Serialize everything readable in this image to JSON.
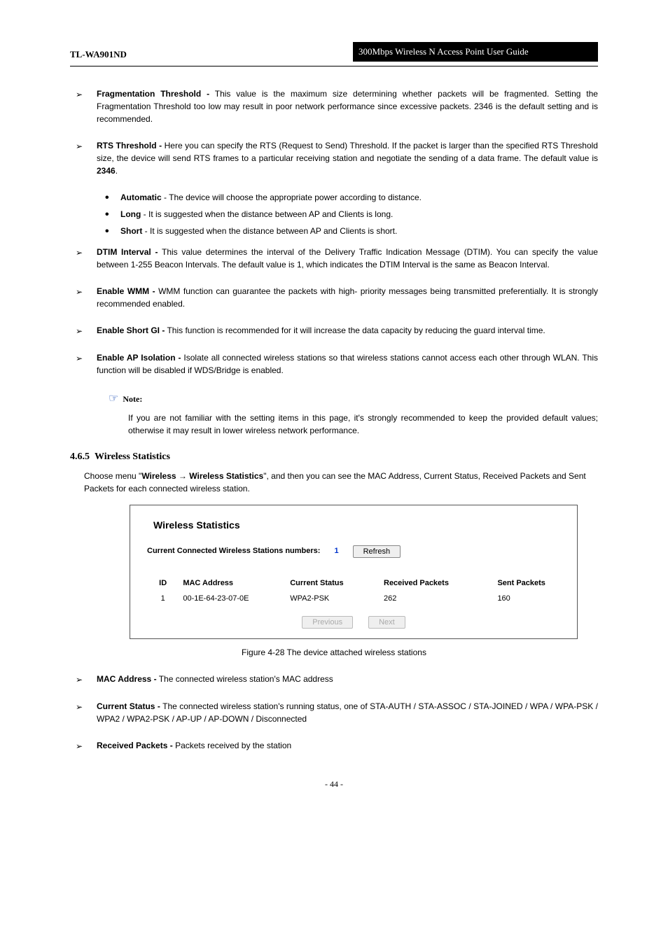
{
  "header": {
    "left": "TL-WA901ND",
    "right": "300Mbps Wireless N Access Point User Guide"
  },
  "bullets": [
    {
      "term": "Fragmentation Threshold -",
      "body": "This value is the maximum size determining whether packets will be fragmented. Setting the Fragmentation Threshold too low may result in poor network performance since excessive packets. 2346 is the default setting and is recommended."
    },
    {
      "term": "RTS Threshold -",
      "body": "Here you can specify the RTS (Request to Send) Threshold. If the packet is larger than the specified RTS Threshold size, the device will send RTS frames to a particular receiving station and negotiate the sending of a data frame. The default value is ",
      "tail": "2346",
      "after": "."
    },
    {
      "term": "DTIM Interval -",
      "body": "This value determines the interval of the Delivery Traffic Indication Message (DTIM). You can specify the value between 1-255 Beacon Intervals. The default value is 1, which indicates the DTIM Interval is the same as Beacon Interval."
    },
    {
      "term": "Enable WMM -",
      "body": "WMM function can guarantee the packets with high- priority messages being transmitted preferentially. It is strongly recommended enabled."
    },
    {
      "term": "Enable Short GI -",
      "body": "This function is recommended for it will increase the data capacity by reducing the guard interval time."
    },
    {
      "term": "Enable AP Isolation -",
      "body": "Isolate all connected wireless stations so that wireless stations cannot access each other through WLAN. This function will be disabled if WDS/Bridge is enabled."
    }
  ],
  "sublist": {
    "b1": "Automatic",
    "b1_after": " - The device will choose the appropriate power according to distance.",
    "b2": "Long",
    "b2_after": " - It is suggested when the distance between AP and Clients is long.",
    "b3": "Short",
    "b3_after": " - It is suggested when the distance between AP and Clients is short."
  },
  "note": {
    "label": "Note:",
    "text": "If you are not familiar with the setting items in this page, it's strongly recommended to keep the provided default values; otherwise it may result in lower wireless network performance."
  },
  "section": {
    "num": "4.6.5",
    "title": "Wireless Statistics"
  },
  "choose": {
    "pre": "Choose menu \"",
    "a": "Wireless",
    "b": "Wireless Statistics",
    "post": "\", and then you can see the MAC Address, Current Status, Received Packets and Sent Packets for each connected wireless station."
  },
  "shot": {
    "title": "Wireless Statistics",
    "row_label": "Current Connected Wireless Stations numbers:",
    "count": "1",
    "refresh": "Refresh",
    "hd_id": "ID",
    "hd_mac": "MAC Address",
    "hd_status": "Current Status",
    "hd_rx": "Received Packets",
    "hd_tx": "Sent Packets",
    "r_id": "1",
    "r_mac": "00-1E-64-23-07-0E",
    "r_status": "WPA2-PSK",
    "r_rx": "262",
    "r_tx": "160",
    "prev": "Previous",
    "next": "Next"
  },
  "fig_caption": "Figure 4-28 The device attached wireless stations",
  "post_bullets": [
    {
      "term": "MAC Address -",
      "body": "The connected wireless station's MAC address"
    },
    {
      "term": "Current Status -",
      "body": "The connected wireless station's running status, one of STA-AUTH / STA-ASSOC / STA-JOINED / WPA / WPA-PSK / WPA2 / WPA2-PSK / AP-UP / AP-DOWN / Disconnected"
    },
    {
      "term": "Received Packets -",
      "body": "Packets received by the station"
    }
  ],
  "page_number": "- 44 -"
}
